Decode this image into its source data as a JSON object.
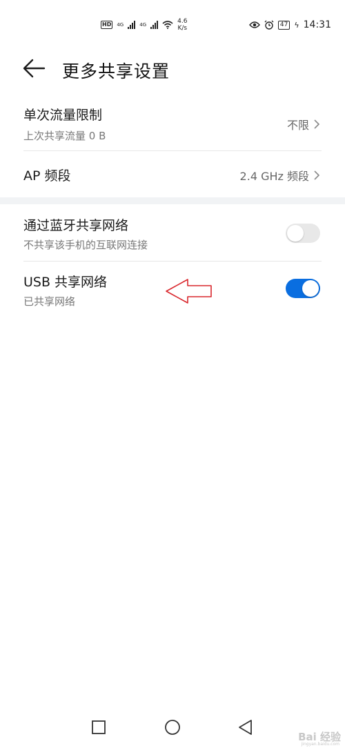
{
  "status_bar": {
    "hd_label": "HD",
    "net_type_1": "4G",
    "net_type_2": "4G",
    "speed_value": "4.6",
    "speed_unit": "K/s",
    "battery": "47",
    "time": "14:31"
  },
  "header": {
    "title": "更多共享设置"
  },
  "settings": {
    "data_limit": {
      "title": "单次流量限制",
      "subtitle": "上次共享流量 0 B",
      "value": "不限"
    },
    "ap_band": {
      "title": "AP 频段",
      "value": "2.4 GHz 频段"
    },
    "bluetooth_share": {
      "title": "通过蓝牙共享网络",
      "subtitle": "不共享该手机的互联网连接",
      "enabled": false
    },
    "usb_share": {
      "title": "USB 共享网络",
      "subtitle": "已共享网络",
      "enabled": true
    }
  },
  "colors": {
    "toggle_on": "#0a6ee0",
    "toggle_off": "#e8e8e8",
    "annotation_arrow": "#d9262c"
  },
  "watermark": {
    "text": "Bai 经验",
    "sub": "jingyan.baidu.com"
  }
}
